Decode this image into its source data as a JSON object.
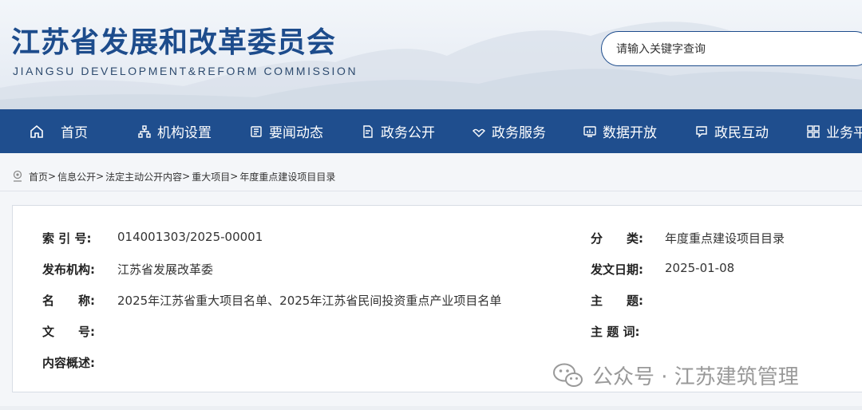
{
  "header": {
    "title": "江苏省发展和改革委员会",
    "subtitle": "JIANGSU DEVELOPMENT&REFORM COMMISSION",
    "search_placeholder": "请输入关键字查询"
  },
  "nav": {
    "items": [
      {
        "label": "首页",
        "icon": "home-icon"
      },
      {
        "label": "机构设置",
        "icon": "org-icon"
      },
      {
        "label": "要闻动态",
        "icon": "news-icon"
      },
      {
        "label": "政务公开",
        "icon": "document-icon"
      },
      {
        "label": "政务服务",
        "icon": "service-icon"
      },
      {
        "label": "数据开放",
        "icon": "data-icon"
      },
      {
        "label": "政民互动",
        "icon": "chat-icon"
      },
      {
        "label": "业务平",
        "icon": "grid-icon"
      }
    ]
  },
  "breadcrumb": {
    "icon": "location-icon",
    "items": [
      "首页",
      "信息公开",
      "法定主动公开内容",
      "重大项目",
      "年度重点建设项目目录"
    ],
    "separator": ">"
  },
  "info": {
    "index_label": "索 引 号:",
    "index_value": "014001303/2025-00001",
    "category_label": "分　　类:",
    "category_value": "年度重点建设项目目录",
    "publisher_label": "发布机构:",
    "publisher_value": "江苏省发展改革委",
    "date_label": "发文日期:",
    "date_value": "2025-01-08",
    "name_label": "名　　称:",
    "name_value": "2025年江苏省重大项目名单、2025年江苏省民间投资重点产业项目名单",
    "topic_label": "主　　题:",
    "docno_label": "文　　号:",
    "keywords_label": "主 题 词:",
    "summary_label": "内容概述:"
  },
  "watermark": {
    "text": "公众号 · 江苏建筑管理",
    "icon": "wechat-icon"
  }
}
